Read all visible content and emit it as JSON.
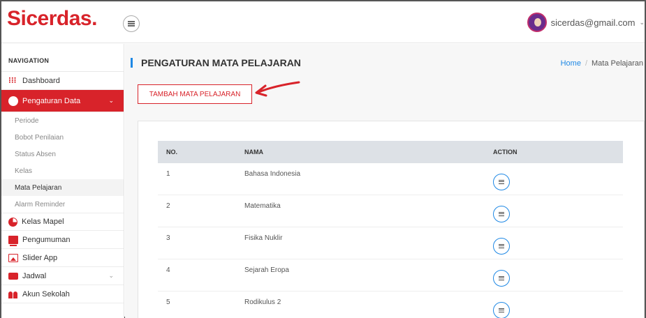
{
  "header": {
    "brand": "Sicerdas.",
    "user_email": "sicerdas@gmail.com"
  },
  "sidebar": {
    "heading": "NAVIGATION",
    "items": [
      {
        "label": "Dashboard",
        "icon": "grid-icon"
      },
      {
        "label": "Pengaturan Data",
        "icon": "cloud-icon",
        "active": true
      },
      {
        "label": "Kelas Mapel",
        "icon": "pie-icon"
      },
      {
        "label": "Pengumuman",
        "icon": "board-icon"
      },
      {
        "label": "Slider App",
        "icon": "image-icon"
      },
      {
        "label": "Jadwal",
        "icon": "briefcase-icon"
      },
      {
        "label": "Akun Sekolah",
        "icon": "users-icon"
      }
    ],
    "sub_items": [
      "Periode",
      "Bobot Penilaian",
      "Status Absen",
      "Kelas",
      "Mata Pelajaran",
      "Alarm Reminder"
    ]
  },
  "main": {
    "title": "PENGATURAN MATA PELAJARAN",
    "breadcrumb": {
      "home": "Home",
      "separator": "/",
      "current": "Mata Pelajaran"
    },
    "add_button": "TAMBAH MATA PELAJARAN",
    "table": {
      "headers": [
        "NO.",
        "NAMA",
        "ACTION"
      ],
      "rows": [
        {
          "no": "1",
          "nama": "Bahasa Indonesia"
        },
        {
          "no": "2",
          "nama": "Matematika"
        },
        {
          "no": "3",
          "nama": "Fisika Nuklir"
        },
        {
          "no": "4",
          "nama": "Sejarah Eropa"
        },
        {
          "no": "5",
          "nama": "Rodikulus 2"
        }
      ]
    }
  },
  "colors": {
    "brand": "#d8232a",
    "accent": "#1e88e5"
  }
}
